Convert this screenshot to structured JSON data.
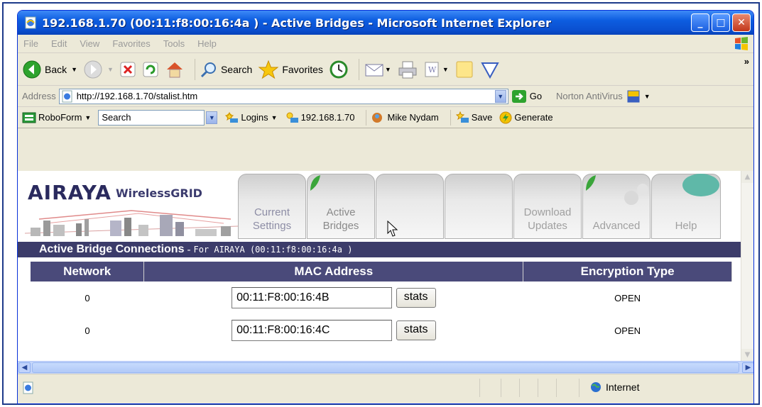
{
  "window": {
    "title": "192.168.1.70 (00:11:f8:00:16:4a ) - Active Bridges - Microsoft Internet Explorer"
  },
  "menu": [
    "File",
    "Edit",
    "View",
    "Favorites",
    "Tools",
    "Help"
  ],
  "toolbar": {
    "back": "Back",
    "search": "Search",
    "favorites": "Favorites"
  },
  "address": {
    "label": "Address",
    "url": "http://192.168.1.70/stalist.htm",
    "go": "Go",
    "norton": "Norton AntiVirus"
  },
  "roboform": {
    "name": "RoboForm",
    "search_value": "Search",
    "logins": "Logins",
    "ip": "192.168.1.70",
    "user": "Mike Nydam",
    "save": "Save",
    "generate": "Generate"
  },
  "page": {
    "logo": "AIRAYA",
    "logo_sub": "WirelessGRID",
    "tabs": [
      {
        "line1": "Current",
        "line2": "Settings"
      },
      {
        "line1": "Active",
        "line2": "Bridges"
      },
      {
        "line1": "",
        "line2": ""
      },
      {
        "line1": "",
        "line2": ""
      },
      {
        "line1": "Download",
        "line2": "Updates"
      },
      {
        "line1": "",
        "line2": "Advanced"
      },
      {
        "line1": "",
        "line2": "Help"
      }
    ],
    "section_title": "Active Bridge Connections",
    "section_sep": "-",
    "section_for": "For AIRAYA (00:11:f8:00:16:4a )",
    "columns": [
      "Network",
      "MAC Address",
      "Encryption Type"
    ],
    "rows": [
      {
        "network": "0",
        "mac": "00:11:F8:00:16:4B",
        "stats": "stats",
        "encryption": "OPEN"
      },
      {
        "network": "0",
        "mac": "00:11:F8:00:16:4C",
        "stats": "stats",
        "encryption": "OPEN"
      }
    ]
  },
  "status": {
    "zone": "Internet"
  }
}
